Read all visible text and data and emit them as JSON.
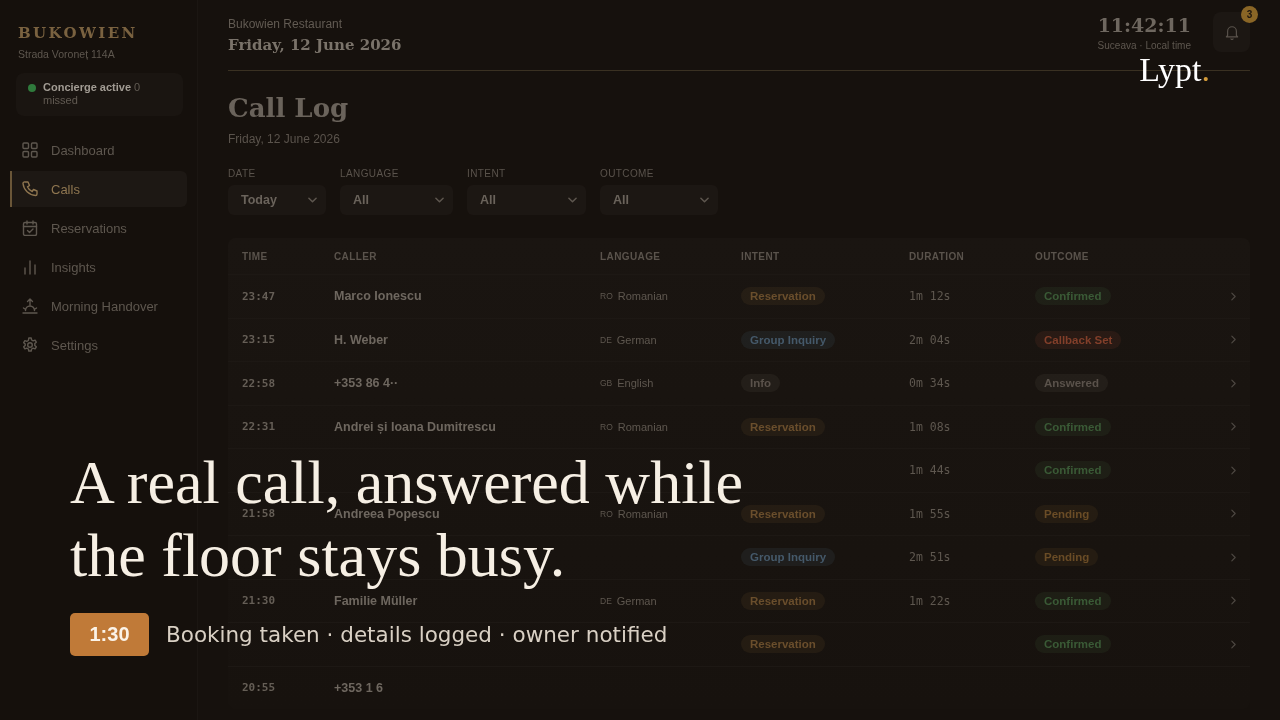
{
  "sidebar": {
    "brand": "BUKOWIEN",
    "address": "Strada Voroneț 114A",
    "status": {
      "label": "Concierge active",
      "missed": "0 missed",
      "active": true
    },
    "nav": [
      {
        "label": "Dashboard",
        "selected": false
      },
      {
        "label": "Calls",
        "selected": true
      },
      {
        "label": "Reservations",
        "selected": false
      },
      {
        "label": "Insights",
        "selected": false
      },
      {
        "label": "Morning Handover",
        "selected": false
      },
      {
        "label": "Settings",
        "selected": false
      }
    ]
  },
  "header": {
    "restaurant": "Bukowien Restaurant",
    "date": "Friday, 12 June 2026",
    "clock": "11:42:11",
    "clock_caption": "Suceava · Local time",
    "notifications": "3"
  },
  "page": {
    "title": "Call Log",
    "subtitle": "Friday, 12 June 2026",
    "filters": [
      {
        "label": "DATE",
        "value": "Today"
      },
      {
        "label": "LANGUAGE",
        "value": "All"
      },
      {
        "label": "INTENT",
        "value": "All"
      },
      {
        "label": "OUTCOME",
        "value": "All"
      }
    ]
  },
  "table": {
    "columns": [
      "TIME",
      "CALLER",
      "LANGUAGE",
      "INTENT",
      "DURATION",
      "OUTCOME"
    ],
    "rows": [
      {
        "time": "23:47",
        "caller": "Marco Ionescu",
        "language": {
          "code": "RO",
          "name": "Romanian"
        },
        "intent": {
          "label": "Reservation",
          "color": "#6a4e2c"
        },
        "duration": "1m 12s",
        "outcome": {
          "label": "Confirmed",
          "color": "#3a5a36"
        }
      },
      {
        "time": "23:15",
        "caller": "H. Weber",
        "language": {
          "code": "DE",
          "name": "German"
        },
        "intent": {
          "label": "Group Inquiry",
          "color": "#45596a"
        },
        "duration": "2m 04s",
        "outcome": {
          "label": "Callback Set",
          "color": "#823f2a"
        }
      },
      {
        "time": "22:58",
        "caller": "+353 86 4··",
        "language": {
          "code": "GB",
          "name": "English"
        },
        "intent": {
          "label": "Info",
          "color": "#5a524b"
        },
        "duration": "0m 34s",
        "outcome": {
          "label": "Answered",
          "color": "#5a524b"
        }
      },
      {
        "time": "22:31",
        "caller": "Andrei și Ioana Dumitrescu",
        "language": {
          "code": "RO",
          "name": "Romanian"
        },
        "intent": {
          "label": "Reservation",
          "color": "#6a4e2c"
        },
        "duration": "1m 08s",
        "outcome": {
          "label": "Confirmed",
          "color": "#3a5a36"
        }
      },
      {
        "duration": "1m 44s",
        "outcome": {
          "label": "Confirmed",
          "color": "#3a5a36"
        }
      },
      {
        "time": "21:58",
        "caller": "Andreea Popescu",
        "language": {
          "code": "RO",
          "name": "Romanian"
        },
        "intent": {
          "label": "Reservation",
          "color": "#6a4e2c"
        },
        "duration": "1m 55s",
        "outcome": {
          "label": "Pending",
          "color": "#6a4c26"
        }
      },
      {
        "intent": {
          "label": "Group Inquiry",
          "color": "#45596a"
        },
        "duration": "2m 51s",
        "outcome": {
          "label": "Pending",
          "color": "#6a4c26"
        }
      },
      {
        "time": "21:30",
        "caller": "Familie Müller",
        "language": {
          "code": "DE",
          "name": "German"
        },
        "intent": {
          "label": "Reservation",
          "color": "#6a4e2c"
        },
        "duration": "1m 22s",
        "outcome": {
          "label": "Confirmed",
          "color": "#3a5a36"
        }
      },
      {
        "intent": {
          "label": "Reservation",
          "color": "#6a4e2c"
        },
        "outcome": {
          "label": "Confirmed",
          "color": "#3a5a36"
        }
      },
      {
        "time": "20:55",
        "caller": "+353 1 6"
      }
    ]
  },
  "overlay": {
    "headline_lines": [
      "A real call, answered while",
      "the floor stays busy."
    ],
    "badge": "1:30",
    "caption": "Booking taken · details logged · owner notified"
  },
  "logo": {
    "name": "Lypt",
    "dot": "."
  }
}
